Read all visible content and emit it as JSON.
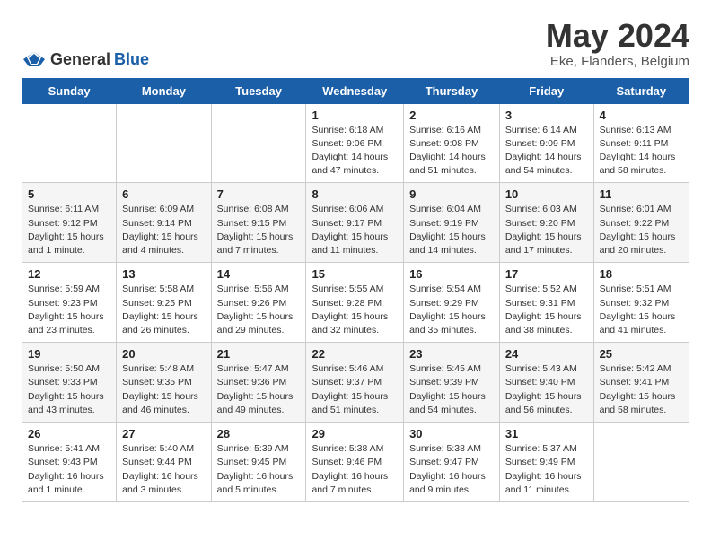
{
  "header": {
    "logo_general": "General",
    "logo_blue": "Blue",
    "title": "May 2024",
    "location": "Eke, Flanders, Belgium"
  },
  "weekdays": [
    "Sunday",
    "Monday",
    "Tuesday",
    "Wednesday",
    "Thursday",
    "Friday",
    "Saturday"
  ],
  "weeks": [
    [
      {
        "day": "",
        "sunrise": "",
        "sunset": "",
        "daylight": ""
      },
      {
        "day": "",
        "sunrise": "",
        "sunset": "",
        "daylight": ""
      },
      {
        "day": "",
        "sunrise": "",
        "sunset": "",
        "daylight": ""
      },
      {
        "day": "1",
        "sunrise": "Sunrise: 6:18 AM",
        "sunset": "Sunset: 9:06 PM",
        "daylight": "Daylight: 14 hours and 47 minutes."
      },
      {
        "day": "2",
        "sunrise": "Sunrise: 6:16 AM",
        "sunset": "Sunset: 9:08 PM",
        "daylight": "Daylight: 14 hours and 51 minutes."
      },
      {
        "day": "3",
        "sunrise": "Sunrise: 6:14 AM",
        "sunset": "Sunset: 9:09 PM",
        "daylight": "Daylight: 14 hours and 54 minutes."
      },
      {
        "day": "4",
        "sunrise": "Sunrise: 6:13 AM",
        "sunset": "Sunset: 9:11 PM",
        "daylight": "Daylight: 14 hours and 58 minutes."
      }
    ],
    [
      {
        "day": "5",
        "sunrise": "Sunrise: 6:11 AM",
        "sunset": "Sunset: 9:12 PM",
        "daylight": "Daylight: 15 hours and 1 minute."
      },
      {
        "day": "6",
        "sunrise": "Sunrise: 6:09 AM",
        "sunset": "Sunset: 9:14 PM",
        "daylight": "Daylight: 15 hours and 4 minutes."
      },
      {
        "day": "7",
        "sunrise": "Sunrise: 6:08 AM",
        "sunset": "Sunset: 9:15 PM",
        "daylight": "Daylight: 15 hours and 7 minutes."
      },
      {
        "day": "8",
        "sunrise": "Sunrise: 6:06 AM",
        "sunset": "Sunset: 9:17 PM",
        "daylight": "Daylight: 15 hours and 11 minutes."
      },
      {
        "day": "9",
        "sunrise": "Sunrise: 6:04 AM",
        "sunset": "Sunset: 9:19 PM",
        "daylight": "Daylight: 15 hours and 14 minutes."
      },
      {
        "day": "10",
        "sunrise": "Sunrise: 6:03 AM",
        "sunset": "Sunset: 9:20 PM",
        "daylight": "Daylight: 15 hours and 17 minutes."
      },
      {
        "day": "11",
        "sunrise": "Sunrise: 6:01 AM",
        "sunset": "Sunset: 9:22 PM",
        "daylight": "Daylight: 15 hours and 20 minutes."
      }
    ],
    [
      {
        "day": "12",
        "sunrise": "Sunrise: 5:59 AM",
        "sunset": "Sunset: 9:23 PM",
        "daylight": "Daylight: 15 hours and 23 minutes."
      },
      {
        "day": "13",
        "sunrise": "Sunrise: 5:58 AM",
        "sunset": "Sunset: 9:25 PM",
        "daylight": "Daylight: 15 hours and 26 minutes."
      },
      {
        "day": "14",
        "sunrise": "Sunrise: 5:56 AM",
        "sunset": "Sunset: 9:26 PM",
        "daylight": "Daylight: 15 hours and 29 minutes."
      },
      {
        "day": "15",
        "sunrise": "Sunrise: 5:55 AM",
        "sunset": "Sunset: 9:28 PM",
        "daylight": "Daylight: 15 hours and 32 minutes."
      },
      {
        "day": "16",
        "sunrise": "Sunrise: 5:54 AM",
        "sunset": "Sunset: 9:29 PM",
        "daylight": "Daylight: 15 hours and 35 minutes."
      },
      {
        "day": "17",
        "sunrise": "Sunrise: 5:52 AM",
        "sunset": "Sunset: 9:31 PM",
        "daylight": "Daylight: 15 hours and 38 minutes."
      },
      {
        "day": "18",
        "sunrise": "Sunrise: 5:51 AM",
        "sunset": "Sunset: 9:32 PM",
        "daylight": "Daylight: 15 hours and 41 minutes."
      }
    ],
    [
      {
        "day": "19",
        "sunrise": "Sunrise: 5:50 AM",
        "sunset": "Sunset: 9:33 PM",
        "daylight": "Daylight: 15 hours and 43 minutes."
      },
      {
        "day": "20",
        "sunrise": "Sunrise: 5:48 AM",
        "sunset": "Sunset: 9:35 PM",
        "daylight": "Daylight: 15 hours and 46 minutes."
      },
      {
        "day": "21",
        "sunrise": "Sunrise: 5:47 AM",
        "sunset": "Sunset: 9:36 PM",
        "daylight": "Daylight: 15 hours and 49 minutes."
      },
      {
        "day": "22",
        "sunrise": "Sunrise: 5:46 AM",
        "sunset": "Sunset: 9:37 PM",
        "daylight": "Daylight: 15 hours and 51 minutes."
      },
      {
        "day": "23",
        "sunrise": "Sunrise: 5:45 AM",
        "sunset": "Sunset: 9:39 PM",
        "daylight": "Daylight: 15 hours and 54 minutes."
      },
      {
        "day": "24",
        "sunrise": "Sunrise: 5:43 AM",
        "sunset": "Sunset: 9:40 PM",
        "daylight": "Daylight: 15 hours and 56 minutes."
      },
      {
        "day": "25",
        "sunrise": "Sunrise: 5:42 AM",
        "sunset": "Sunset: 9:41 PM",
        "daylight": "Daylight: 15 hours and 58 minutes."
      }
    ],
    [
      {
        "day": "26",
        "sunrise": "Sunrise: 5:41 AM",
        "sunset": "Sunset: 9:43 PM",
        "daylight": "Daylight: 16 hours and 1 minute."
      },
      {
        "day": "27",
        "sunrise": "Sunrise: 5:40 AM",
        "sunset": "Sunset: 9:44 PM",
        "daylight": "Daylight: 16 hours and 3 minutes."
      },
      {
        "day": "28",
        "sunrise": "Sunrise: 5:39 AM",
        "sunset": "Sunset: 9:45 PM",
        "daylight": "Daylight: 16 hours and 5 minutes."
      },
      {
        "day": "29",
        "sunrise": "Sunrise: 5:38 AM",
        "sunset": "Sunset: 9:46 PM",
        "daylight": "Daylight: 16 hours and 7 minutes."
      },
      {
        "day": "30",
        "sunrise": "Sunrise: 5:38 AM",
        "sunset": "Sunset: 9:47 PM",
        "daylight": "Daylight: 16 hours and 9 minutes."
      },
      {
        "day": "31",
        "sunrise": "Sunrise: 5:37 AM",
        "sunset": "Sunset: 9:49 PM",
        "daylight": "Daylight: 16 hours and 11 minutes."
      },
      {
        "day": "",
        "sunrise": "",
        "sunset": "",
        "daylight": ""
      }
    ]
  ]
}
